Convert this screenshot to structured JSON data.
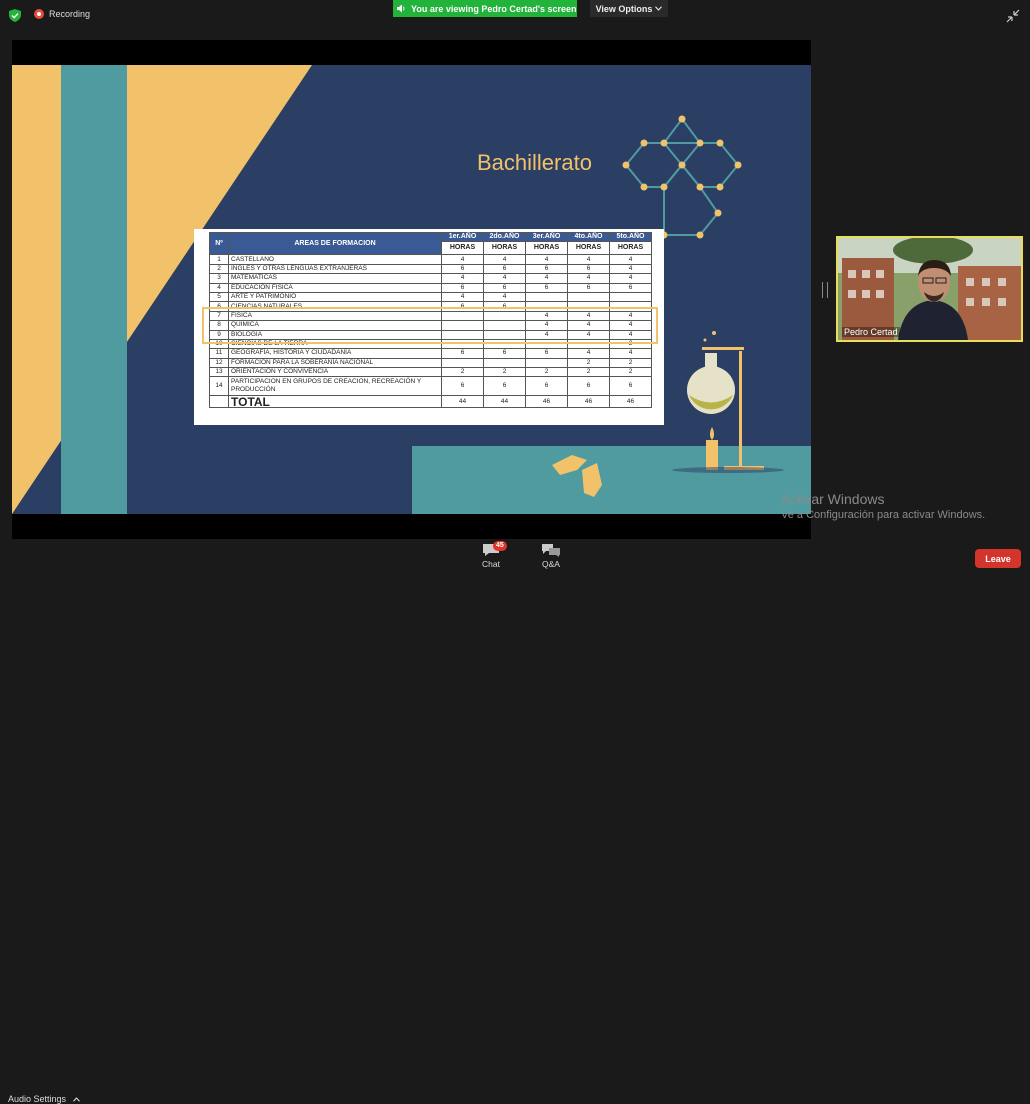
{
  "topbar": {
    "recording_label": "Recording",
    "viewing_label": "You are viewing Pedro Certad's screen",
    "view_options_label": "View Options"
  },
  "slide": {
    "title": "Bachillerato",
    "table": {
      "header_num": "Nº",
      "header_area": "AREAS DE FORMACION",
      "years": [
        "1er.AÑO",
        "2do.AÑO",
        "3er.AÑO",
        "4to.AÑO",
        "5to.AÑO"
      ],
      "hours_label": "HORAS",
      "rows": [
        {
          "n": "1",
          "area": "CASTELLANO",
          "v": [
            "4",
            "4",
            "4",
            "4",
            "4"
          ]
        },
        {
          "n": "2",
          "area": "INGLES Y  OTRAS LENGUAS EXTRANJERAS",
          "v": [
            "6",
            "6",
            "6",
            "6",
            "4"
          ]
        },
        {
          "n": "3",
          "area": "MATEMATICAS",
          "v": [
            "4",
            "4",
            "4",
            "4",
            "4"
          ]
        },
        {
          "n": "4",
          "area": "EDUCACIÓN  FISICA",
          "v": [
            "6",
            "6",
            "6",
            "6",
            "6"
          ]
        },
        {
          "n": "5",
          "area": "ARTE Y PATRIMONIO",
          "v": [
            "4",
            "4",
            "",
            "",
            ""
          ]
        },
        {
          "n": "6",
          "area": " CIENCIAS NATURALES",
          "v": [
            "6",
            "6",
            "",
            "",
            ""
          ]
        },
        {
          "n": "7",
          "area": "FISICA",
          "v": [
            "",
            "",
            "4",
            "4",
            "4"
          ]
        },
        {
          "n": "8",
          "area": "QUIMICA",
          "v": [
            "",
            "",
            "4",
            "4",
            "4"
          ]
        },
        {
          "n": "9",
          "area": "BIOLOGIA",
          "v": [
            "",
            "",
            "4",
            "4",
            "4"
          ]
        },
        {
          "n": "10",
          "area": "CIENCIAS DE LA TIERRA",
          "v": [
            "",
            "",
            "",
            "",
            "2"
          ]
        },
        {
          "n": "11",
          "area": "GEOGRAFÍA, HISTORIA Y CIUDADANÍA",
          "v": [
            "6",
            "6",
            "6",
            "4",
            "4"
          ]
        },
        {
          "n": "12",
          "area": "FORMACION PARA LA SOBERANÍA NACIONAL",
          "v": [
            "",
            "",
            "",
            "2",
            "2"
          ]
        },
        {
          "n": "13",
          "area": "ORIENTACIÓN Y CONVIVENCIA",
          "v": [
            "2",
            "2",
            "2",
            "2",
            "2"
          ]
        },
        {
          "n": "14",
          "area": "PARTICIPACION EN GRUPOS DE CREACION, RECREACIÓN Y PRODUCCIÓN",
          "v": [
            "6",
            "6",
            "6",
            "6",
            "6"
          ]
        }
      ],
      "total_label": "TOTAL",
      "totals": [
        "44",
        "44",
        "46",
        "46",
        "46"
      ]
    }
  },
  "watermark": {
    "line1": "Activar Windows",
    "line2": "Ve a Configuración para activar Windows."
  },
  "video": {
    "participant_name": "Pedro Certad"
  },
  "bottombar": {
    "audio_settings_label": "Audio Settings",
    "chat_label": "Chat",
    "chat_badge": "45",
    "qa_label": "Q&A",
    "leave_label": "Leave"
  },
  "colors": {
    "slide_bg": "#2b3e63",
    "accent_yellow": "#f2c26b",
    "accent_teal": "#4f9ba0",
    "viewing_green": "#22b33a",
    "leave_red": "#d3342b"
  }
}
